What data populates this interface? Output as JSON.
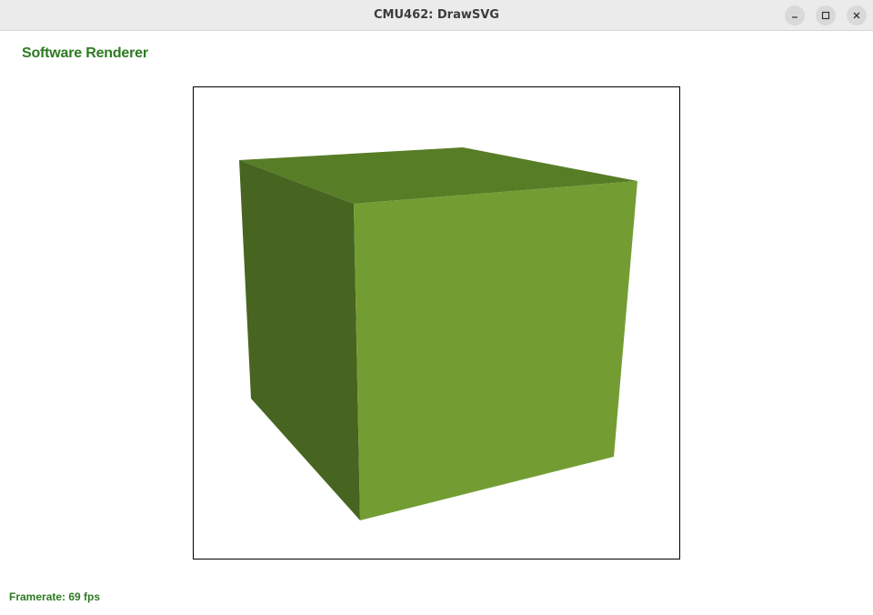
{
  "window": {
    "title": "CMU462: DrawSVG",
    "controls": {
      "minimize": "minimize-icon",
      "maximize": "maximize-icon",
      "close": "close-icon"
    }
  },
  "renderer": {
    "label": "Software Renderer"
  },
  "status": {
    "framerate_label": "Framerate:",
    "framerate_value": "69 fps"
  },
  "scene": {
    "shape": "cube",
    "colors": {
      "top_face": "#587d27",
      "left_face": "#476520",
      "front_face": "#739d33",
      "border": "#000000"
    }
  },
  "colors": {
    "label_green": "#2d7a22",
    "titlebar_bg": "#ebebeb"
  }
}
